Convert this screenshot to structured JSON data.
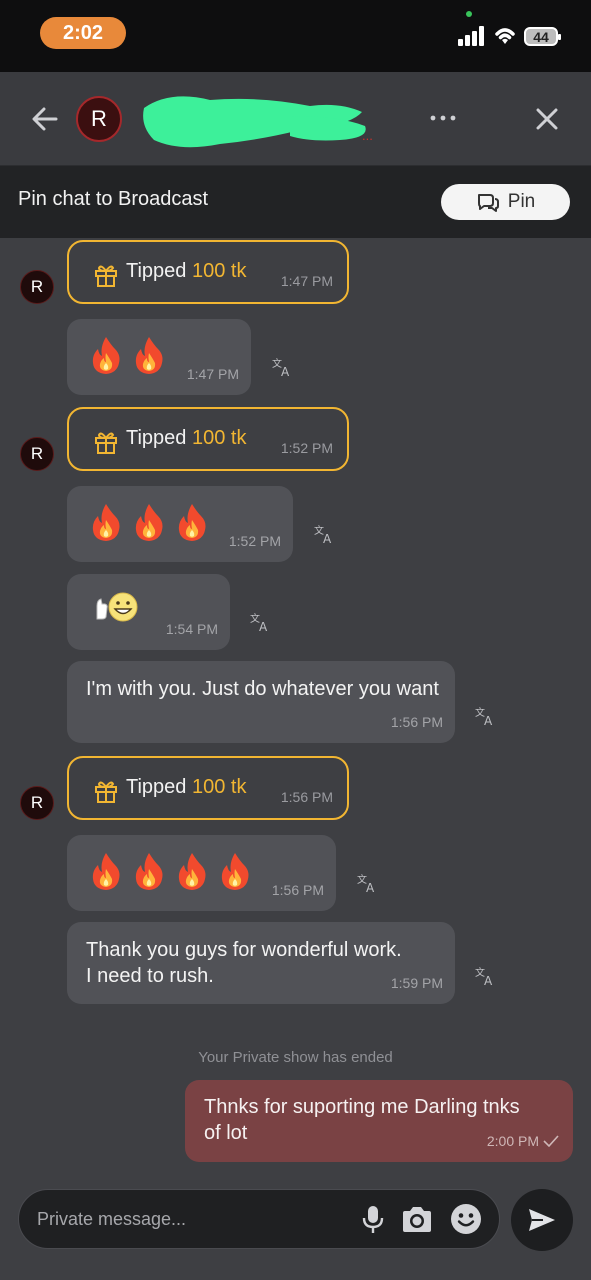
{
  "status_bar": {
    "time": "2:02",
    "battery": "44"
  },
  "header": {
    "avatar_initial": "R"
  },
  "pin_bar": {
    "text": "Pin chat to Broadcast",
    "button_label": "Pin"
  },
  "messages": {
    "tip1": {
      "label": "Tipped",
      "amount": "100 tk",
      "time": "1:47 PM",
      "avatar": "R"
    },
    "fire1": {
      "count": 2,
      "time": "1:47 PM"
    },
    "tip2": {
      "label": "Tipped",
      "amount": "100 tk",
      "time": "1:52 PM",
      "avatar": "R"
    },
    "fire2": {
      "count": 3,
      "time": "1:52 PM"
    },
    "thumbs": {
      "time": "1:54 PM"
    },
    "text1": {
      "text": "I'm with you. Just do whatever you want",
      "time": "1:56 PM"
    },
    "tip3": {
      "label": "Tipped",
      "amount": "100 tk",
      "time": "1:56 PM",
      "avatar": "R"
    },
    "fire3": {
      "count": 4,
      "time": "1:56 PM"
    },
    "text2": {
      "text": "Thank you guys for wonderful work. I need to rush.",
      "time": "1:59 PM"
    }
  },
  "system_note": "Your Private show has ended",
  "own_message": {
    "text": "Thnks for suporting me Darling tnks of lot",
    "time": "2:00 PM"
  },
  "composer": {
    "placeholder": "Private message..."
  },
  "colors": {
    "accent_tip": "#f2b632",
    "own_bubble": "#7a4244",
    "bubble": "#515257",
    "background": "#3e3f43"
  }
}
